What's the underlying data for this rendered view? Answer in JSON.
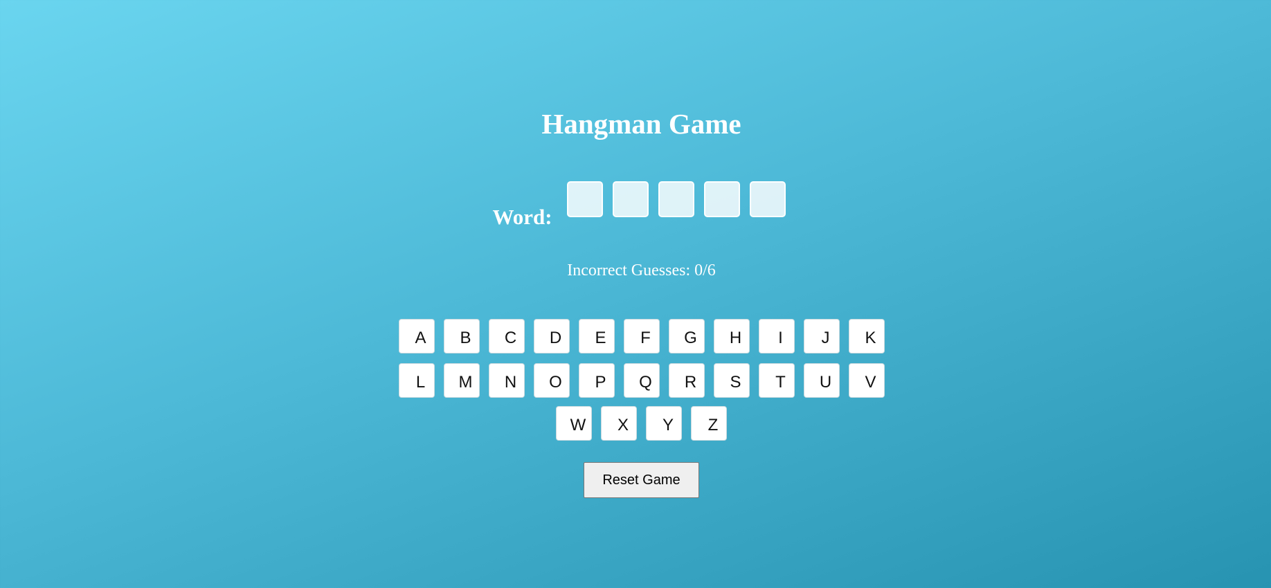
{
  "title": "Hangman Game",
  "word": {
    "label": "Word:",
    "slots": [
      "",
      "",
      "",
      "",
      ""
    ]
  },
  "status": {
    "incorrect_text": "Incorrect Guesses: 0/6"
  },
  "keyboard": {
    "rows": [
      [
        "A",
        "B",
        "C",
        "D",
        "E",
        "F",
        "G",
        "H",
        "I",
        "J",
        "K"
      ],
      [
        "L",
        "M",
        "N",
        "O",
        "P",
        "Q",
        "R",
        "S",
        "T",
        "U",
        "V"
      ],
      [
        "W",
        "X",
        "Y",
        "Z"
      ]
    ]
  },
  "controls": {
    "reset_label": "Reset Game"
  },
  "colors": {
    "background_start": "#6ad5ef",
    "background_end": "#2793b1",
    "text": "#ffffff",
    "key_background": "#ffffff"
  }
}
